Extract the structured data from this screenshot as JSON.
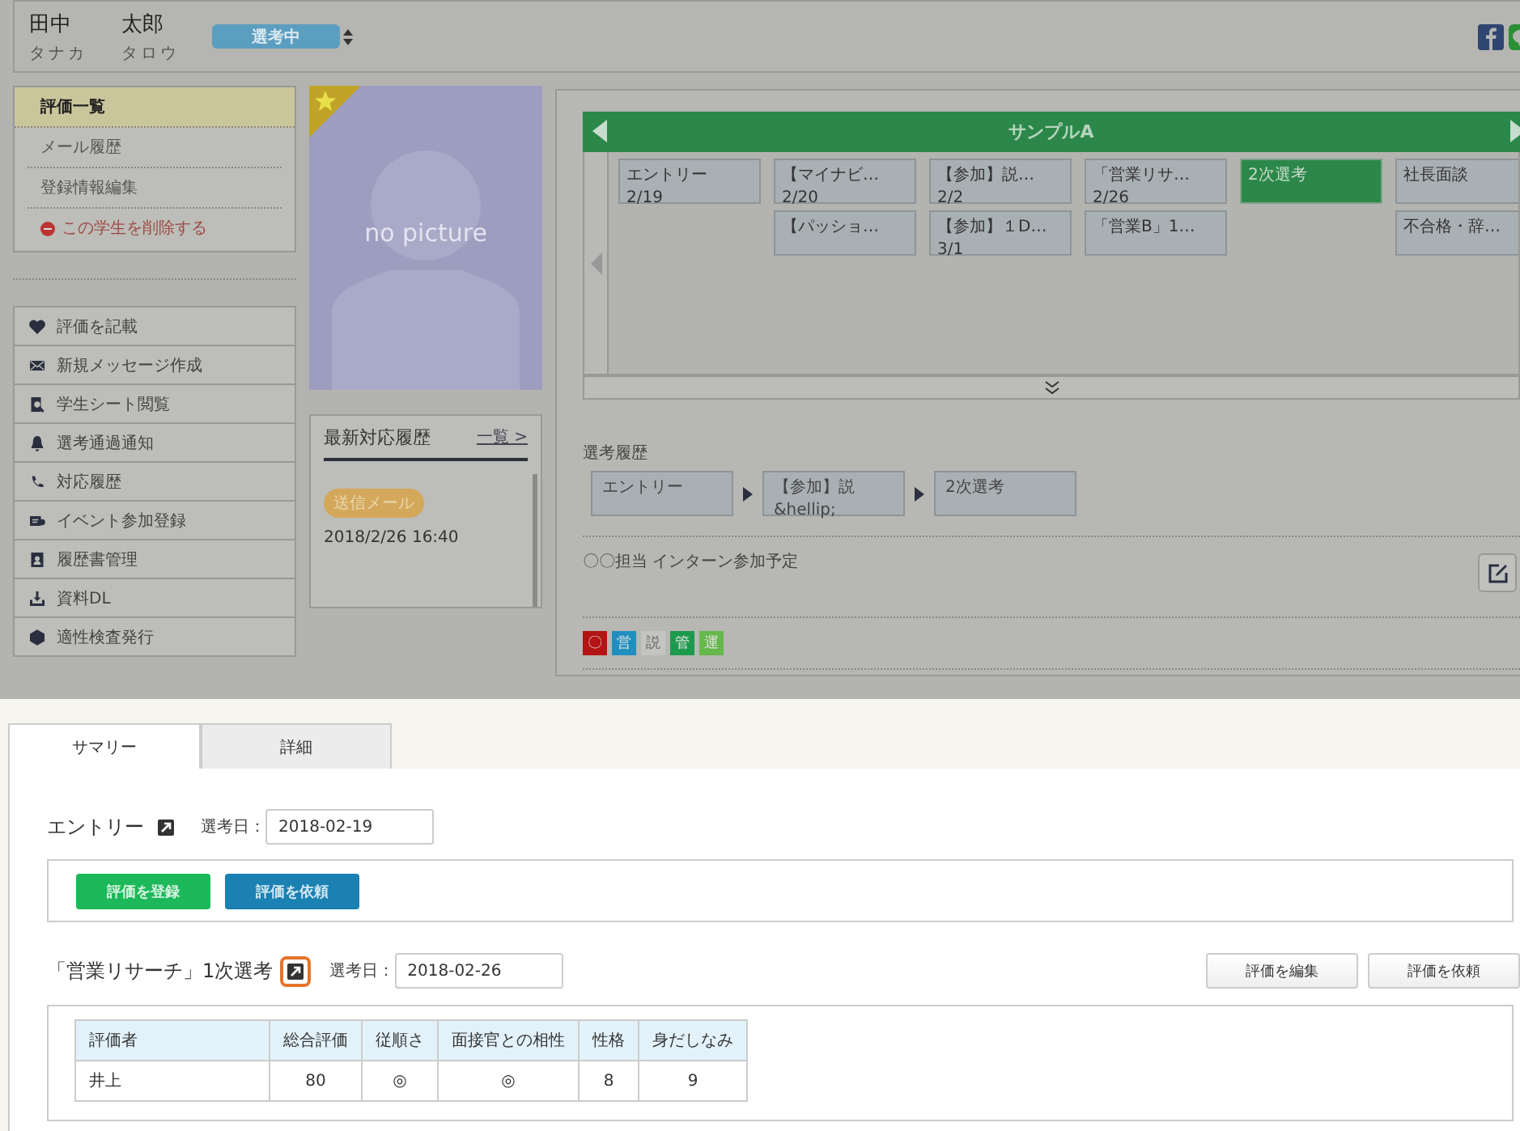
{
  "header": {
    "family_name": "田中",
    "family_kana": "タナカ",
    "given_name": "太郎",
    "given_kana": "タロウ",
    "status": "選考中"
  },
  "menu": [
    {
      "label": "評価一覧",
      "selected": true,
      "kind": "link"
    },
    {
      "label": "メール履歴",
      "selected": false,
      "kind": "link"
    },
    {
      "label": "登録情報編集",
      "selected": false,
      "kind": "link"
    },
    {
      "label": "この学生を削除する",
      "selected": false,
      "kind": "danger"
    }
  ],
  "actions": [
    "評価を記載",
    "新規メッセージ作成",
    "学生シート閲覧",
    "選考通過通知",
    "対応履歴",
    "イベント参加登録",
    "履歴書管理",
    "資料DL",
    "適性検査発行"
  ],
  "photo": {
    "placeholder": "no picture",
    "starred": true
  },
  "recent": {
    "title": "最新対応履歴",
    "link": "一覧 >",
    "badge": "送信メール",
    "datetime": "2018/2/26 16:40"
  },
  "board": {
    "title": "サンプルA",
    "columns": [
      {
        "cards": [
          {
            "label": "エントリー",
            "date": "2/19",
            "selected": false
          }
        ]
      },
      {
        "cards": [
          {
            "label": "【マイナビ…",
            "date": "2/20",
            "selected": false
          },
          {
            "label": "【パッショ…",
            "selected": false
          }
        ]
      },
      {
        "cards": [
          {
            "label": "【参加】説…",
            "date": "2/2",
            "selected": false
          },
          {
            "label": "【参加】１D…",
            "date": "3/1",
            "selected": false
          }
        ]
      },
      {
        "cards": [
          {
            "label": "「営業リサ…",
            "date": "2/26",
            "selected": false
          },
          {
            "label": "「営業B」1…",
            "selected": false
          }
        ]
      },
      {
        "cards": [
          {
            "label": "2次選考",
            "selected": true
          }
        ]
      },
      {
        "cards": [
          {
            "label": "社長面談",
            "selected": false
          },
          {
            "label": "不合格・辞…",
            "selected": false
          }
        ]
      }
    ]
  },
  "history": {
    "label": "選考履歴",
    "steps": [
      "エントリー",
      "【参加】説 &hellip;",
      "2次選考"
    ]
  },
  "memo": "〇〇担当 インターン参加予定",
  "tags": [
    {
      "label": "〇",
      "color": "#b41414"
    },
    {
      "label": "営",
      "color": "#1f8fbf"
    },
    {
      "label": "説",
      "color": "#c4c4c2"
    },
    {
      "label": "管",
      "color": "#1e9a4e"
    },
    {
      "label": "運",
      "color": "#66b84c"
    }
  ],
  "tabs": [
    {
      "label": "サマリー",
      "selected": true
    },
    {
      "label": "詳細",
      "selected": false
    }
  ],
  "sections": [
    {
      "kind": "actions",
      "title": "エントリー",
      "highlighted": false,
      "date_label": "選考日：",
      "date": "2018-02-19",
      "buttons": [
        {
          "label": "評価を登録",
          "kind": "green"
        },
        {
          "label": "評価を依頼",
          "kind": "blue"
        }
      ]
    },
    {
      "kind": "table",
      "title": "「営業リサーチ」1次選考",
      "highlighted": true,
      "date_label": "選考日：",
      "date": "2018-02-26",
      "buttons": [
        {
          "label": "評価を編集",
          "kind": "plain"
        },
        {
          "label": "評価を依頼",
          "kind": "plain"
        }
      ],
      "table": {
        "columns": [
          "評価者",
          "総合評価",
          "従順さ",
          "面接官との相性",
          "性格",
          "身だしなみ"
        ],
        "rows": [
          [
            "井上",
            "80",
            "◎",
            "◎",
            "8",
            "9"
          ]
        ]
      }
    }
  ]
}
